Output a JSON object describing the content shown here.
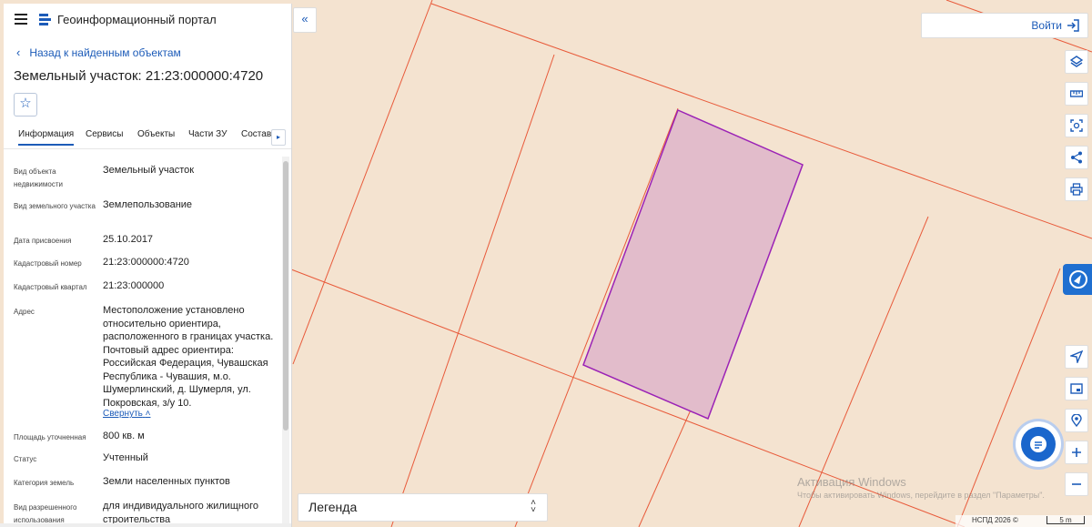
{
  "portal": {
    "title": "Геоинформационный портал"
  },
  "nav": {
    "back_label": "Назад к найденным объектам"
  },
  "object": {
    "title": "Земельный участок: 21:23:000000:4720"
  },
  "tabs": [
    "Информация",
    "Сервисы",
    "Объекты",
    "Части ЗУ",
    "Состав"
  ],
  "info": [
    {
      "label": "Вид объекта недвижимости",
      "value": "Земельный участок"
    },
    {
      "label": "Вид земельного участка",
      "value": "Землепользование"
    },
    {
      "label": "Дата присвоения",
      "value": "25.10.2017"
    },
    {
      "label": "Кадастровый номер",
      "value": "21:23:000000:4720"
    },
    {
      "label": "Кадастровый квартал",
      "value": "21:23:000000"
    },
    {
      "label": "Адрес",
      "value": "Местоположение установлено относительно ориентира, расположенного в границах участка. Почтовый адрес ориентира: Российская Федерация, Чувашская Республика - Чувашия, м.о. Шумерлинский, д. Шумерля, ул. Покровская, з/у 10."
    },
    {
      "label": "Площадь уточненная",
      "value": "800 кв. м"
    },
    {
      "label": "Статус",
      "value": "Учтенный"
    },
    {
      "label": "Категория земель",
      "value": "Земли населенных пунктов"
    },
    {
      "label": "Вид разрешенного использования",
      "value": "для индивидуального жилищного строительства"
    }
  ],
  "collapse_link": "Свернуть",
  "header": {
    "login_label": "Войти"
  },
  "legend": {
    "label": "Легенда"
  },
  "watermark": {
    "title": "Активация Windows",
    "text": "Чтобы активировать Windows, перейдите в раздел \"Параметры\"."
  },
  "attribution": {
    "copyright": "НСПД 2026 ©",
    "scale": "5 m"
  },
  "colors": {
    "accent": "#1c5bb8",
    "parcel_line": "#e85a3a",
    "selected_fill": "#e2bccb",
    "selected_stroke": "#9b22b6",
    "map_bg": "#f4e3d0"
  },
  "icons": [
    "menu-icon",
    "portal-logo-icon",
    "chevron-left-icon",
    "star-icon",
    "double-chevron-left-icon",
    "login-icon",
    "layers-icon",
    "ruler-icon",
    "select-area-icon",
    "share-icon",
    "print-icon",
    "locate-icon",
    "minimap-icon",
    "geolocation-icon",
    "zoom-in-icon",
    "zoom-out-icon",
    "chat-icon"
  ]
}
